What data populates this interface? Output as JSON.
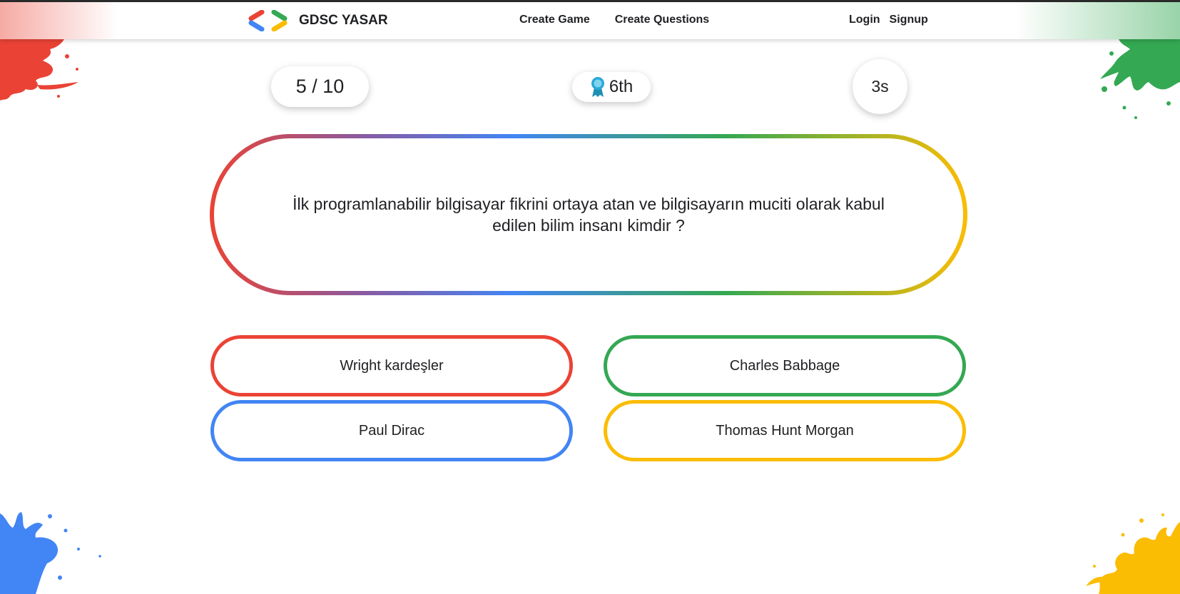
{
  "colors": {
    "red": "#EA4335",
    "blue": "#4285F4",
    "green": "#34A853",
    "yellow": "#FBBC04"
  },
  "navbar": {
    "brand": {
      "logo_icon": "gdsc-brackets-logo",
      "name": "GDSC YASAR"
    },
    "links": [
      "Create Game",
      "Create Questions"
    ],
    "auth": {
      "login": "Login",
      "signup": "Signup"
    }
  },
  "status": {
    "progress": "5 / 10",
    "rank": {
      "icon": "award-ribbon-icon",
      "label": "6th"
    },
    "timer": "3s"
  },
  "question": {
    "text": "İlk programlanabilir bilgisayar fikrini ortaya atan ve bilgisayarın muciti olarak kabul edilen bilim insanı kimdir ?"
  },
  "answers": [
    {
      "label": "Wright kardeşler",
      "color": "#EA4335"
    },
    {
      "label": "Charles Babbage",
      "color": "#34A853"
    },
    {
      "label": "Paul Dirac",
      "color": "#4285F4"
    },
    {
      "label": "Thomas Hunt Morgan",
      "color": "#FBBC04"
    }
  ]
}
